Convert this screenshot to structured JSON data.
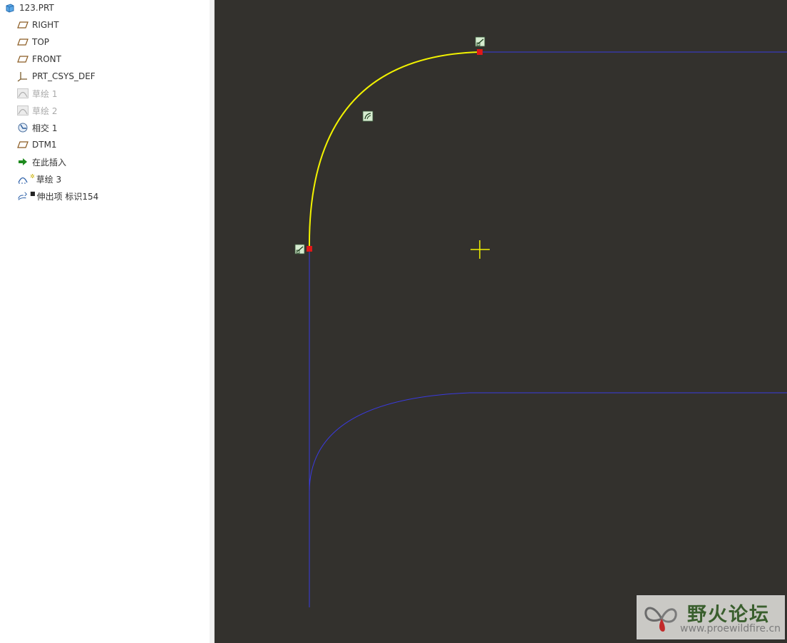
{
  "model_tree": {
    "root": "123.PRT",
    "items": [
      {
        "label": "RIGHT",
        "icon": "datum-plane-icon"
      },
      {
        "label": "TOP",
        "icon": "datum-plane-icon"
      },
      {
        "label": "FRONT",
        "icon": "datum-plane-icon"
      },
      {
        "label": "PRT_CSYS_DEF",
        "icon": "coordinate-system-icon"
      },
      {
        "label": "草绘 1",
        "icon": "sketch-icon",
        "dimmed": true
      },
      {
        "label": "草绘 2",
        "icon": "sketch-icon",
        "dimmed": true
      },
      {
        "label": "相交 1",
        "icon": "intersect-icon"
      },
      {
        "label": "DTM1",
        "icon": "datum-plane-icon"
      },
      {
        "label": "在此插入",
        "icon": "insert-here-arrow-icon"
      },
      {
        "label": "草绘 3",
        "icon": "sketch-icon"
      },
      {
        "label": "伸出项 标识154",
        "icon": "protrusion-icon"
      }
    ]
  },
  "watermark": {
    "title": "野火论坛",
    "url": "www.proewildfire.cn"
  },
  "colors": {
    "canvas_background": "#33312d",
    "reference_geometry": "#3a3adf",
    "selected_arc": "#f2f200",
    "endpoint": "#e01818",
    "cursor": "#f2f200"
  }
}
